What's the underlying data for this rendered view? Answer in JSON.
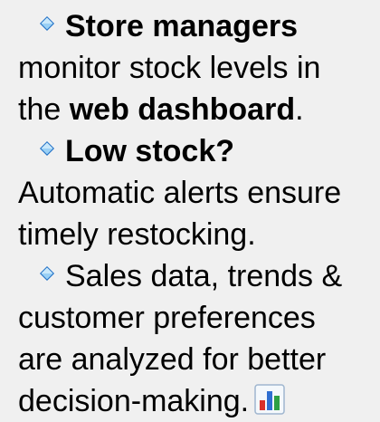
{
  "bullets": [
    {
      "lead": "Store managers",
      "text_1": "monitor stock levels in",
      "text_2_prefix": "the ",
      "text_2_bold": "web dashboard",
      "text_2_suffix": "."
    },
    {
      "lead": "Low stock?",
      "text_1": "Automatic alerts ensure",
      "text_2": "timely restocking."
    },
    {
      "lead": "Sales data, trends &",
      "text_1": "customer preferences",
      "text_2": "are analyzed for better",
      "text_3": "decision-making."
    }
  ],
  "icons": {
    "bullet": "diamond-bullet-icon",
    "chart": "bar-chart-icon"
  },
  "colors": {
    "background": "#f0f0f0",
    "text": "#000000",
    "bullet_light": "#9ad0f5",
    "bullet_dark": "#1f6fc5",
    "chart_bg": "#f4f8fc",
    "chart_border": "#9fb6cf",
    "chart_red": "#d9302a",
    "chart_blue": "#2f6fd1",
    "chart_green": "#2ea043"
  }
}
